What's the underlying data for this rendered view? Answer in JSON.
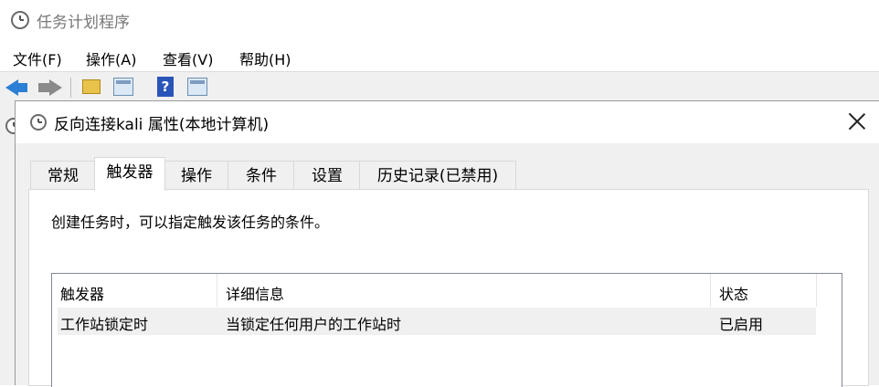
{
  "app": {
    "title": "任务计划程序"
  },
  "menu": {
    "file": "文件(F)",
    "action": "操作(A)",
    "view": "查看(V)",
    "help": "帮助(H)"
  },
  "toolbar": {
    "help_glyph": "?"
  },
  "dialog": {
    "title": "反向连接kali 属性(本地计算机)",
    "tabs": [
      {
        "label": "常规"
      },
      {
        "label": "触发器"
      },
      {
        "label": "操作"
      },
      {
        "label": "条件"
      },
      {
        "label": "设置"
      },
      {
        "label": "历史记录(已禁用)"
      }
    ],
    "active_tab": "触发器",
    "description": "创建任务时，可以指定触发该任务的条件。",
    "triggers_table": {
      "headers": [
        "触发器",
        "详细信息",
        "状态"
      ],
      "rows": [
        [
          "工作站锁定时",
          "当锁定任何用户的工作站时",
          "已启用"
        ]
      ]
    }
  }
}
